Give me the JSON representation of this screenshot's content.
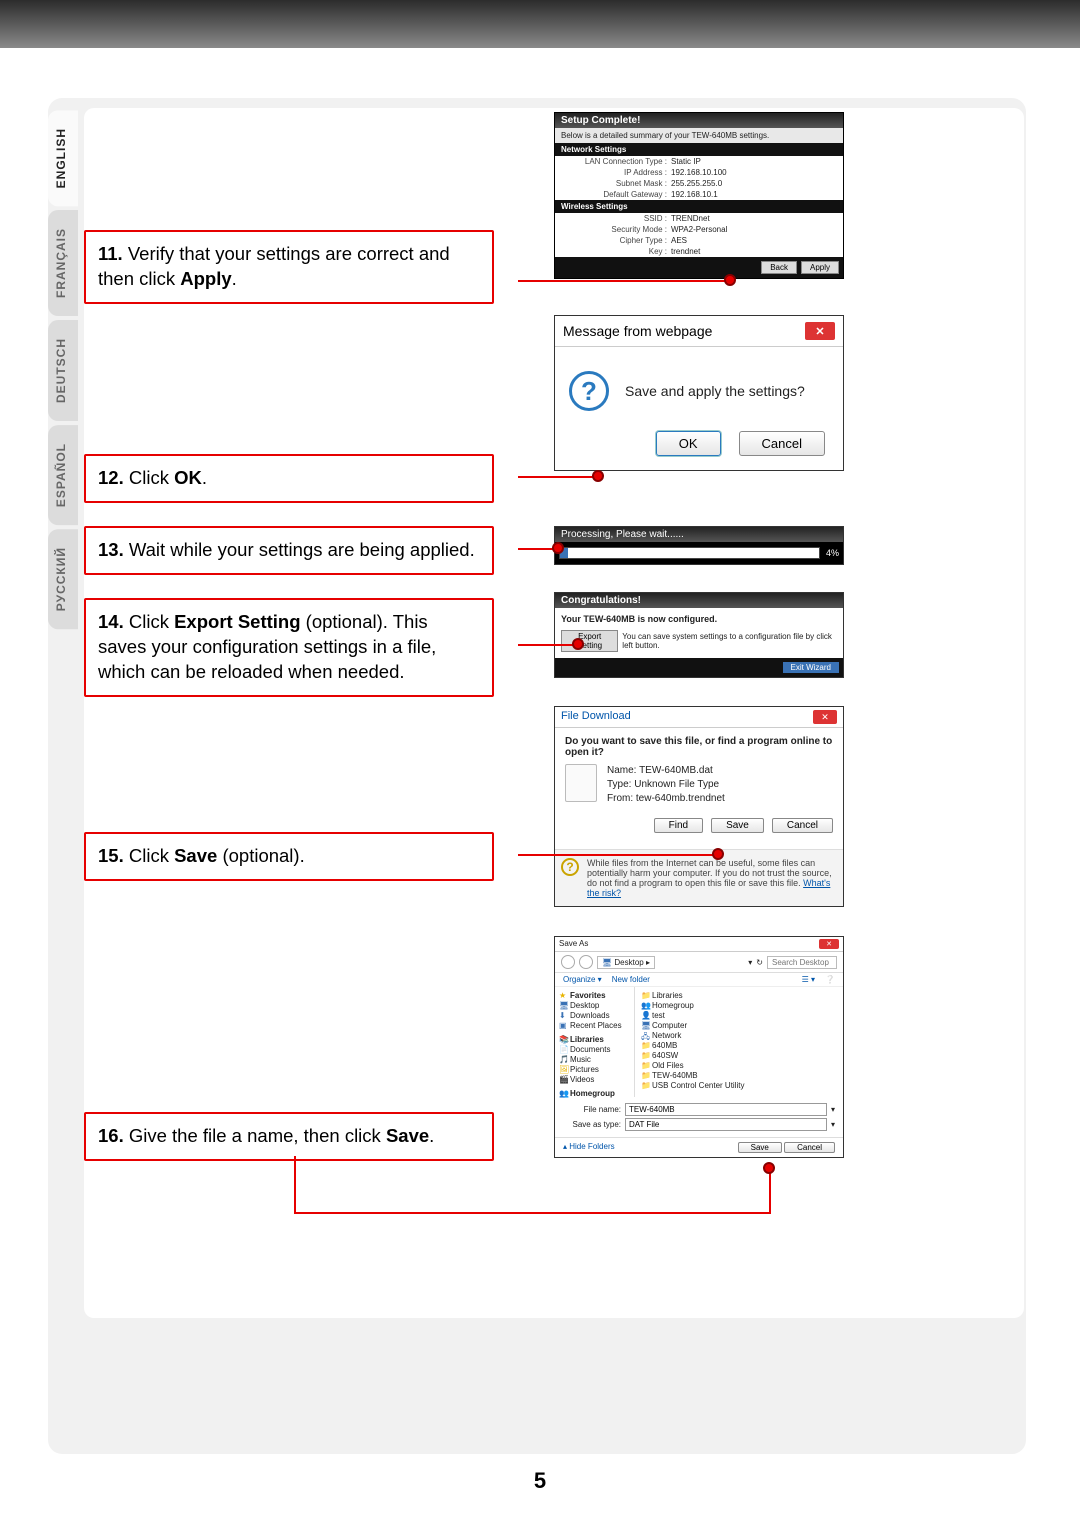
{
  "page_number": "5",
  "languages": [
    {
      "code": "en",
      "label": "ENGLISH",
      "active": true
    },
    {
      "code": "fr",
      "label": "FRANÇAIS",
      "active": false
    },
    {
      "code": "de",
      "label": "DEUTSCH",
      "active": false
    },
    {
      "code": "es",
      "label": "ESPAÑOL",
      "active": false
    },
    {
      "code": "ru",
      "label": "РУССКИЙ",
      "active": false
    }
  ],
  "steps": {
    "s11": {
      "num": "11.",
      "text_a": " Verify that your settings are correct and then click ",
      "bold": "Apply",
      "text_b": "."
    },
    "s12": {
      "num": "12.",
      "text_a": " Click ",
      "bold": "OK",
      "text_b": "."
    },
    "s13": {
      "num": "13.",
      "text_a": " Wait while your settings are being applied."
    },
    "s14": {
      "num": "14.",
      "text_a": " Click ",
      "bold": "Export Setting",
      "text_b": " (optional). This saves your configuration settings in a file, which can be reloaded when needed."
    },
    "s15": {
      "num": "15.",
      "text_a": " Click ",
      "bold": "Save",
      "text_b": " (optional)."
    },
    "s16": {
      "num": "16.",
      "text_a": " Give the file a name, then click ",
      "bold": "Save",
      "text_b": "."
    }
  },
  "shot1": {
    "title": "Setup Complete!",
    "subtitle": "Below is a detailed summary of your TEW-640MB settings.",
    "net_section": "Network Settings",
    "net": [
      {
        "k": "LAN Connection Type :",
        "v": "Static IP"
      },
      {
        "k": "IP Address :",
        "v": "192.168.10.100"
      },
      {
        "k": "Subnet Mask :",
        "v": "255.255.255.0"
      },
      {
        "k": "Default Gateway :",
        "v": "192.168.10.1"
      }
    ],
    "wl_section": "Wireless Settings",
    "wl": [
      {
        "k": "SSID :",
        "v": "TRENDnet"
      },
      {
        "k": "Security Mode :",
        "v": "WPA2-Personal"
      },
      {
        "k": "Cipher Type :",
        "v": "AES"
      },
      {
        "k": "Key :",
        "v": "trendnet"
      }
    ],
    "back": "Back",
    "apply": "Apply"
  },
  "shot2": {
    "title": "Message from webpage",
    "message": "Save and apply the settings?",
    "ok": "OK",
    "cancel": "Cancel"
  },
  "shot3": {
    "title": "Processing, Please wait......",
    "pct": "4%"
  },
  "shot4": {
    "title": "Congratulations!",
    "configured": "Your TEW-640MB is now configured.",
    "export_btn": "Export Setting",
    "export_hint": "You can save system settings to a configuration file by click left button.",
    "exit": "Exit Wizard"
  },
  "shot5": {
    "title": "File Download",
    "question": "Do you want to save this file, or find a program online to open it?",
    "name_k": "Name:",
    "name_v": "TEW-640MB.dat",
    "type_k": "Type:",
    "type_v": "Unknown File Type",
    "from_k": "From:",
    "from_v": "tew-640mb.trendnet",
    "find": "Find",
    "save": "Save",
    "cancel": "Cancel",
    "warn": "While files from the Internet can be useful, some files can potentially harm your computer. If you do not trust the source, do not find a program to open this file or save this file. ",
    "risk": "What's the risk?"
  },
  "shot6": {
    "title": "Save As",
    "location_icon": "Desktop",
    "location": "Desktop  ▸",
    "search_placeholder": "Search Desktop",
    "organize": "Organize ▾",
    "newfolder": "New folder",
    "left_groups": {
      "fav": "Favorites",
      "fav_items": [
        "Desktop",
        "Downloads",
        "Recent Places"
      ],
      "lib": "Libraries",
      "lib_items": [
        "Documents",
        "Music",
        "Pictures",
        "Videos"
      ],
      "home": "Homegroup"
    },
    "right_items": [
      "Libraries",
      "Homegroup",
      "test",
      "Computer",
      "Network",
      "640MB",
      "640SW",
      "Old Files",
      "TEW-640MB",
      "USB Control Center Utility"
    ],
    "filename_label": "File name:",
    "filename_value": "TEW-640MB",
    "saveas_label": "Save as type:",
    "saveas_value": "DAT File",
    "hide": "Hide Folders",
    "save": "Save",
    "cancel": "Cancel"
  }
}
